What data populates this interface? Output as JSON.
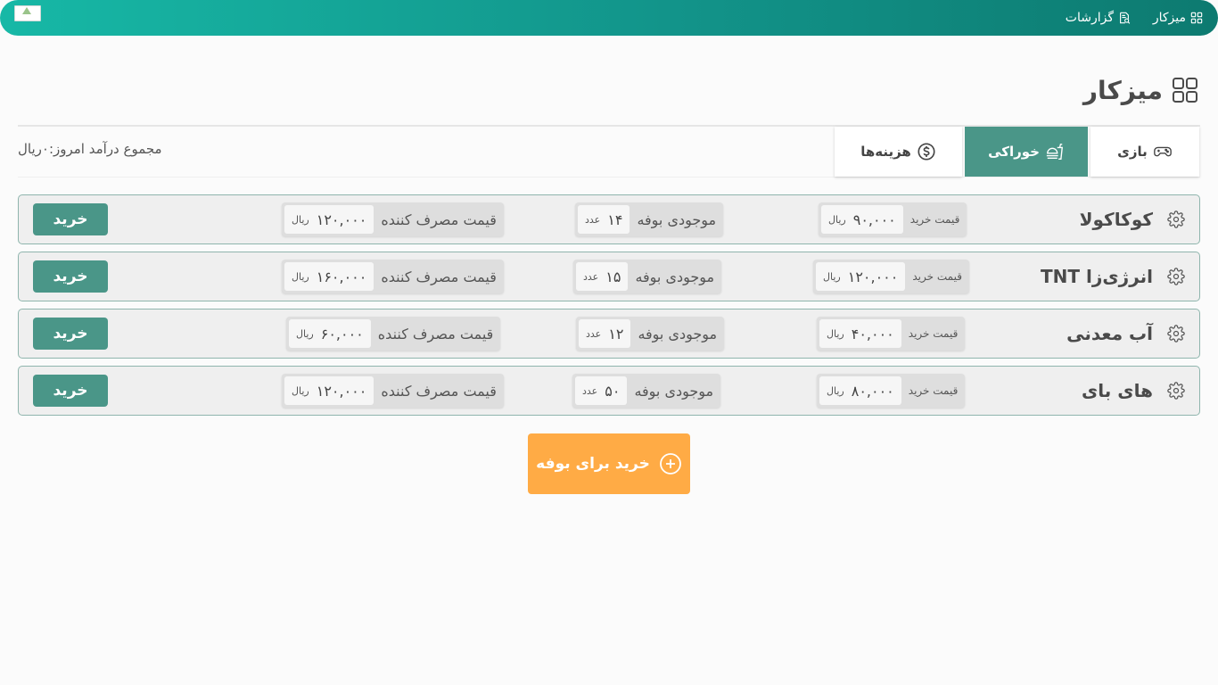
{
  "topbar": {
    "nav": [
      {
        "label": "میزکار",
        "icon": "grid-icon"
      },
      {
        "label": "گزارشات",
        "icon": "report-search-icon"
      }
    ],
    "logo": "broken-image-icon"
  },
  "page": {
    "title": "میزکار",
    "title_icon": "grid-icon"
  },
  "tabs": [
    {
      "label": "بازی",
      "icon": "gamepad-icon",
      "active": false
    },
    {
      "label": "خوراکی",
      "icon": "fast-food-icon",
      "active": true
    },
    {
      "label": "هزینه‌ها",
      "icon": "dollar-circle-icon",
      "active": false
    }
  ],
  "income_label": "مجموع درآمد امروز:۰ریال",
  "labels": {
    "buy_price": "قیمت خرید",
    "stock": "موجودی بوفه",
    "consumer_price": "قیمت مصرف کننده",
    "rial": "ریال",
    "count_unit": "عدد",
    "buy_button": "خرید"
  },
  "products": [
    {
      "name": "کوکاکولا",
      "buy_price": "۹۰,۰۰۰",
      "stock": "۱۴",
      "consumer_price": "۱۲۰,۰۰۰"
    },
    {
      "name": "انرژی‌زا TNT",
      "buy_price": "۱۲۰,۰۰۰",
      "stock": "۱۵",
      "consumer_price": "۱۶۰,۰۰۰"
    },
    {
      "name": "آب معدنی",
      "buy_price": "۴۰,۰۰۰",
      "stock": "۱۲",
      "consumer_price": "۶۰,۰۰۰"
    },
    {
      "name": "های بای",
      "buy_price": "۸۰,۰۰۰",
      "stock": "۵۰",
      "consumer_price": "۱۲۰,۰۰۰"
    }
  ],
  "main_action": {
    "label": "خرید برای بوفه",
    "icon": "plus-circle-icon"
  },
  "colors": {
    "primary": "#4a9688",
    "accent": "#ffab45",
    "topbar_start": "#17b8a6",
    "topbar_end": "#0d7a70"
  }
}
